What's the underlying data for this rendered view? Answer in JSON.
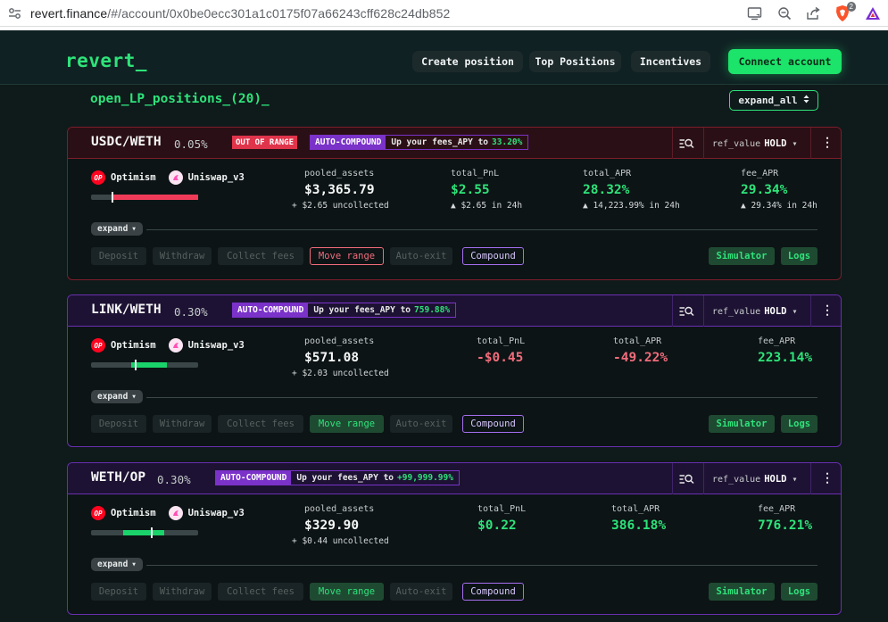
{
  "browser": {
    "url_host": "revert.finance",
    "url_path": "/#/account/0x0be0ecc301a1c0175f07a66243cff628c24db852",
    "extension_badge": "2"
  },
  "header": {
    "logo": "revert_",
    "nav": [
      "Create position",
      "Top Positions",
      "Incentives"
    ],
    "connect": "Connect account"
  },
  "section": {
    "title": "open_LP_positions_(20)_",
    "expand_all": "expand_all"
  },
  "positions": [
    {
      "pair": "USDC/WETH",
      "fee": "0.05%",
      "out_of_range": "OUT OF RANGE",
      "auto_compound": "AUTO-COMPOUND",
      "fees_apy_text": "Up your fees_APY to",
      "fees_apy_value": "33.20%",
      "ref_label": "ref_value",
      "ref_value": "HOLD",
      "chain": "Optimism",
      "protocol": "Uniswap_v3",
      "range_level": 0.0,
      "pooled_label": "pooled_assets",
      "pooled_value": "$3,365.79",
      "pooled_sub": "+ $2.65 uncollected",
      "pnl_label": "total_PnL",
      "pnl_value": "$2.55",
      "pnl_sub": "▲ $2.65 in 24h",
      "apr_label": "total_APR",
      "apr_value": "28.32%",
      "apr_sub": "▲ 14,223.99% in 24h",
      "fee_apr_label": "fee_APR",
      "fee_apr_value": "29.34%",
      "fee_apr_sub": "▲ 29.34% in 24h",
      "expand": "expand",
      "actions": [
        "Deposit",
        "Withdraw",
        "Collect fees",
        "Move range",
        "Auto-exit",
        "Compound"
      ],
      "simulator": "Simulator",
      "logs": "Logs"
    },
    {
      "pair": "LINK/WETH",
      "fee": "0.30%",
      "auto_compound": "AUTO-COMPOUND",
      "fees_apy_text": "Up your fees_APY to",
      "fees_apy_value": "759.88%",
      "ref_label": "ref_value",
      "ref_value": "HOLD",
      "chain": "Optimism",
      "protocol": "Uniswap_v3",
      "pooled_label": "pooled_assets",
      "pooled_value": "$571.08",
      "pooled_sub": "+ $2.03 uncollected",
      "pnl_label": "total_PnL",
      "pnl_value": "-$0.45",
      "apr_label": "total_APR",
      "apr_value": "-49.22%",
      "fee_apr_label": "fee_APR",
      "fee_apr_value": "223.14%",
      "expand": "expand",
      "actions": [
        "Deposit",
        "Withdraw",
        "Collect fees",
        "Move range",
        "Auto-exit",
        "Compound"
      ],
      "simulator": "Simulator",
      "logs": "Logs"
    },
    {
      "pair": "WETH/OP",
      "fee": "0.30%",
      "auto_compound": "AUTO-COMPOUND",
      "fees_apy_text": "Up your fees_APY to",
      "fees_apy_value": "+99,999.99%",
      "ref_label": "ref_value",
      "ref_value": "HOLD",
      "chain": "Optimism",
      "protocol": "Uniswap_v3",
      "pooled_label": "pooled_assets",
      "pooled_value": "$329.90",
      "pooled_sub": "+ $0.44 uncollected",
      "pnl_label": "total_PnL",
      "pnl_value": "$0.22",
      "apr_label": "total_APR",
      "apr_value": "386.18%",
      "fee_apr_label": "fee_APR",
      "fee_apr_value": "776.21%",
      "expand": "expand",
      "actions": [
        "Deposit",
        "Withdraw",
        "Collect fees",
        "Move range",
        "Auto-exit",
        "Compound"
      ],
      "simulator": "Simulator",
      "logs": "Logs"
    }
  ],
  "op_badge": "OP",
  "colors": {
    "accent_green": "#2ee37a",
    "danger_red": "#e0344b",
    "auto_purple": "#7a32c9",
    "background": "#0f1a1b"
  },
  "icons": [
    "site-settings-icon",
    "cast-icon",
    "zoom-icon",
    "share-icon",
    "brave-shield-icon",
    "brave-rewards-icon",
    "search-list-icon",
    "chevron-down-icon",
    "kebab-menu-icon",
    "optimism-icon",
    "uniswap-icon"
  ]
}
